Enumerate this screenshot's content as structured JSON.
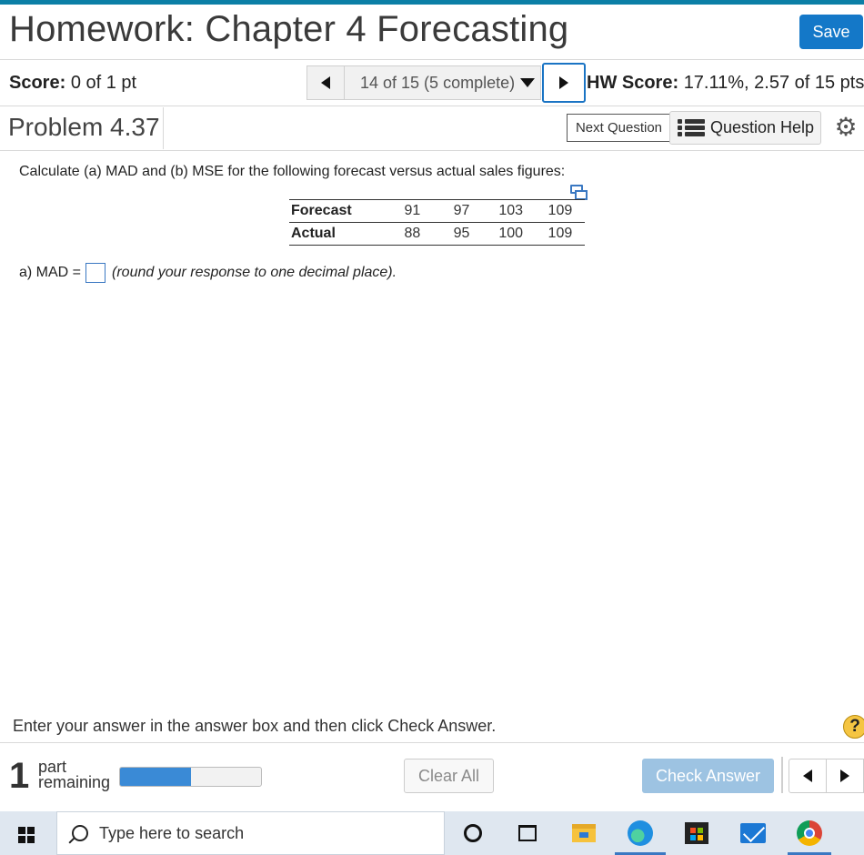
{
  "header": {
    "title": "Homework: Chapter 4 Forecasting",
    "save_label": "Save"
  },
  "score_bar": {
    "score_label": "Score:",
    "score_value": "0 of 1 pt",
    "question_position": "14 of 15 (5 complete)",
    "hw_score_label": "HW Score:",
    "hw_score_value": "17.11%, 2.57 of 15 pts"
  },
  "problem_bar": {
    "problem_title": "Problem 4.37",
    "next_tooltip": "Next Question",
    "question_help_label": "Question Help"
  },
  "question": {
    "prompt": "Calculate (a) MAD and (b) MSE for the following forecast versus actual sales figures:",
    "table": {
      "rows": [
        {
          "label": "Forecast",
          "values": [
            "91",
            "97",
            "103",
            "109"
          ]
        },
        {
          "label": "Actual",
          "values": [
            "88",
            "95",
            "100",
            "109"
          ]
        }
      ]
    },
    "answer_prefix": "a) MAD =",
    "answer_value": "",
    "answer_hint": "(round your response to one decimal place)."
  },
  "footer": {
    "instruction": "Enter your answer in the answer box and then click Check Answer.",
    "help_symbol": "?",
    "parts_count": "1",
    "parts_label_line1": "part",
    "parts_label_line2": "remaining",
    "progress_fraction": 0.5,
    "clear_all_label": "Clear All",
    "check_answer_label": "Check Answer"
  },
  "taskbar": {
    "search_placeholder": "Type here to search",
    "icons": [
      "windows-start-icon",
      "cortana-icon",
      "task-view-icon",
      "file-explorer-icon",
      "edge-icon",
      "store-icon",
      "mail-icon",
      "chrome-icon"
    ]
  },
  "colors": {
    "accent_blue": "#1478c8",
    "top_border": "#0b7fa6",
    "progress_fill": "#3a8ad6",
    "check_answer_bg": "#9dc3e2"
  }
}
